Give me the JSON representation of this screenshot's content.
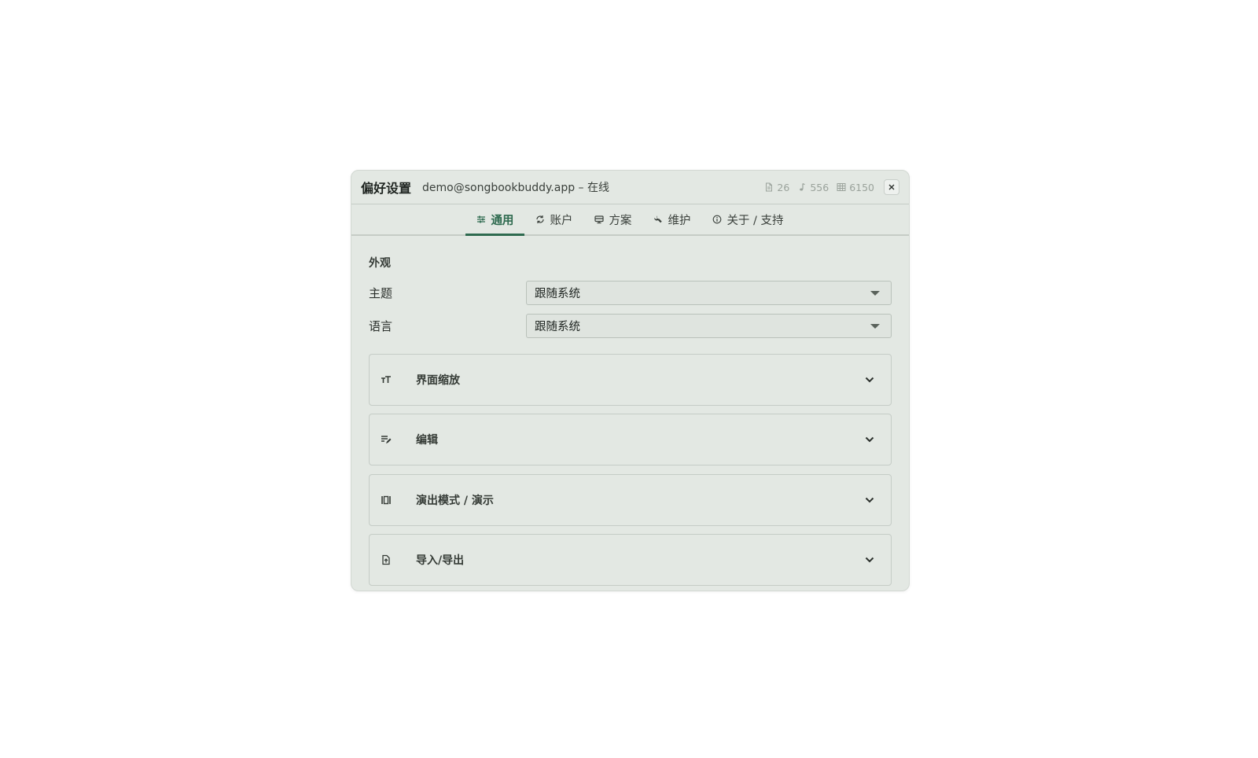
{
  "dialog": {
    "title": "偏好设置",
    "account_status": "demo@songbookbuddy.app – 在线",
    "stats": {
      "documents": "26",
      "songs": "556",
      "sheets": "6150"
    }
  },
  "tabs": [
    {
      "label": "通用",
      "icon": "sliders-icon",
      "active": true
    },
    {
      "label": "账户",
      "icon": "sync-icon",
      "active": false
    },
    {
      "label": "方案",
      "icon": "monitor-icon",
      "active": false
    },
    {
      "label": "维护",
      "icon": "wrench-icon",
      "active": false
    },
    {
      "label": "关于 / 支持",
      "icon": "info-icon",
      "active": false
    }
  ],
  "appearance": {
    "section_label": "外观",
    "theme": {
      "label": "主题",
      "value": "跟随系统"
    },
    "language": {
      "label": "语言",
      "value": "跟随系统"
    }
  },
  "panels": [
    {
      "title": "界面缩放",
      "icon": "text-size-icon"
    },
    {
      "title": "编辑",
      "icon": "edit-note-icon"
    },
    {
      "title": "演出模式 / 演示",
      "icon": "presentation-icon"
    },
    {
      "title": "导入/导出",
      "icon": "file-upload-icon"
    }
  ],
  "colors": {
    "accent": "#2e6a4f",
    "dialog_bg": "#e3e8e3",
    "muted_text": "#9aa29b"
  }
}
